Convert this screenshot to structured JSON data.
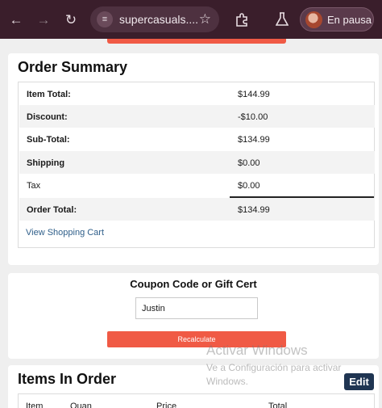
{
  "browser": {
    "url_text": "supercasuals....",
    "profile_label": "En pausa",
    "icons": [
      "back-arrow-icon",
      "forward-arrow-icon",
      "reload-icon",
      "site-settings-icon",
      "star-icon",
      "extensions-icon",
      "labs-flask-icon",
      "profile-avatar"
    ]
  },
  "order_summary": {
    "title": "Order Summary",
    "rows": [
      {
        "label": "Item Total:",
        "value": "$144.99"
      },
      {
        "label": "Discount:",
        "value": "-$10.00"
      },
      {
        "label": "Sub-Total:",
        "value": "$134.99"
      },
      {
        "label": "Shipping",
        "value": "$0.00"
      },
      {
        "label": "Tax",
        "value": "$0.00"
      },
      {
        "label": "Order Total:",
        "value": "$134.99"
      }
    ],
    "view_cart_link": "View Shopping Cart"
  },
  "coupon": {
    "title": "Coupon Code or Gift Cert",
    "input_value": "Justin",
    "button_label": "Recalculate"
  },
  "items_in_order": {
    "title": "Items In Order",
    "columns": [
      "Item",
      "Quan",
      "Price",
      "Total"
    ]
  },
  "watermark": {
    "line1": "Activar Windows",
    "line2": "Ve a Configuración para activar",
    "line3": "Windows."
  },
  "edit_button_label": "Edit",
  "colors": {
    "toolbar_bg": "#3a1e2b",
    "accent_button": "#f05a45",
    "link": "#2f5f8a",
    "edit_button": "#1f3552"
  }
}
